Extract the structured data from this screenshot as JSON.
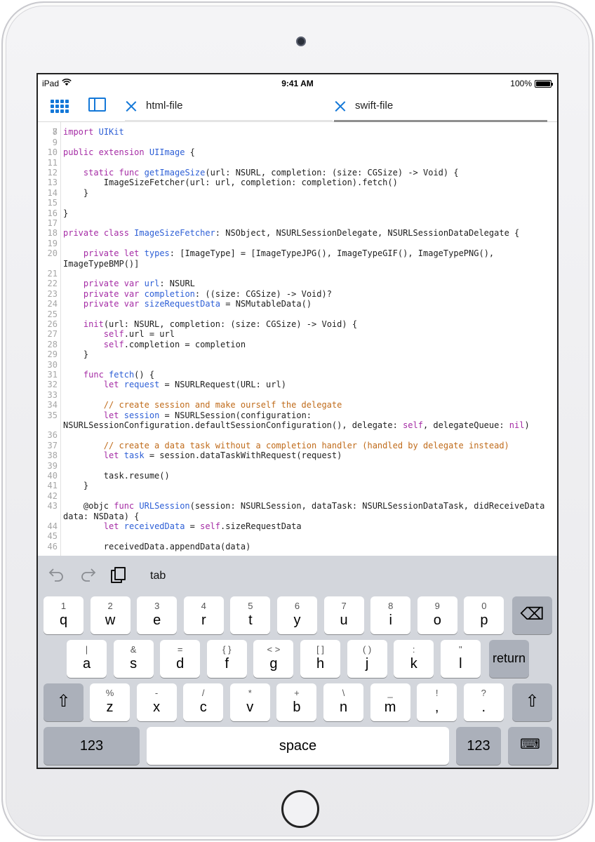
{
  "status_bar": {
    "device": "iPad",
    "time": "9:41 AM",
    "battery": "100%",
    "battery_level": 1.0
  },
  "tabs": [
    {
      "label": "html-file",
      "active": false
    },
    {
      "label": "swift-file",
      "active": true
    }
  ],
  "colors": {
    "accent": "#1478d8",
    "keyword": "#a52ca5",
    "type": "#2d5fd6",
    "comment": "#c06b1a",
    "keyboard_bg": "#d3d6dc"
  },
  "code": {
    "first_line_partial": "7",
    "lines": [
      {
        "n": "8",
        "t": "import UIKit"
      },
      {
        "n": "9",
        "t": ""
      },
      {
        "n": "10",
        "t": "public extension UIImage {"
      },
      {
        "n": "11",
        "t": ""
      },
      {
        "n": "12",
        "t": "    static func getImageSize(url: NSURL, completion: (size: CGSize) -> Void) {"
      },
      {
        "n": "13",
        "t": "        ImageSizeFetcher(url: url, completion: completion).fetch()"
      },
      {
        "n": "14",
        "t": "    }"
      },
      {
        "n": "15",
        "t": ""
      },
      {
        "n": "16",
        "t": "}"
      },
      {
        "n": "17",
        "t": ""
      },
      {
        "n": "18",
        "t": "private class ImageSizeFetcher: NSObject, NSURLSessionDelegate, NSURLSessionDataDelegate {"
      },
      {
        "n": "19",
        "t": ""
      },
      {
        "n": "20",
        "t": "    private let types: [ImageType] = [ImageTypeJPG(), ImageTypeGIF(), ImageTypePNG(),",
        "cont": "ImageTypeBMP()]"
      },
      {
        "n": "21",
        "t": ""
      },
      {
        "n": "22",
        "t": "    private var url: NSURL"
      },
      {
        "n": "23",
        "t": "    private var completion: ((size: CGSize) -> Void)?"
      },
      {
        "n": "24",
        "t": "    private var sizeRequestData = NSMutableData()"
      },
      {
        "n": "25",
        "t": ""
      },
      {
        "n": "26",
        "t": "    init(url: NSURL, completion: (size: CGSize) -> Void) {"
      },
      {
        "n": "27",
        "t": "        self.url = url"
      },
      {
        "n": "28",
        "t": "        self.completion = completion"
      },
      {
        "n": "29",
        "t": "    }"
      },
      {
        "n": "30",
        "t": ""
      },
      {
        "n": "31",
        "t": "    func fetch() {"
      },
      {
        "n": "32",
        "t": "        let request = NSURLRequest(URL: url)"
      },
      {
        "n": "33",
        "t": ""
      },
      {
        "n": "34",
        "t": "        // create session and make ourself the delegate"
      },
      {
        "n": "35",
        "t": "        let session = NSURLSession(configuration:",
        "cont": "NSURLSessionConfiguration.defaultSessionConfiguration(), delegate: self, delegateQueue: nil)"
      },
      {
        "n": "36",
        "t": ""
      },
      {
        "n": "37",
        "t": "        // create a data task without a completion handler (handled by delegate instead)"
      },
      {
        "n": "38",
        "t": "        let task = session.dataTaskWithRequest(request)"
      },
      {
        "n": "39",
        "t": ""
      },
      {
        "n": "40",
        "t": "        task.resume()"
      },
      {
        "n": "41",
        "t": "    }"
      },
      {
        "n": "42",
        "t": ""
      },
      {
        "n": "43",
        "t": "    @objc func URLSession(session: NSURLSession, dataTask: NSURLSessionDataTask, didReceiveData",
        "cont": "data: NSData) {"
      },
      {
        "n": "44",
        "t": "        let receivedData = self.sizeRequestData"
      },
      {
        "n": "45",
        "t": ""
      },
      {
        "n": "46",
        "t": "        receivedData.appendData(data)"
      }
    ]
  },
  "keyboard": {
    "shortcut_tab": "tab",
    "undo_icon": "undo-arrow-icon",
    "redo_icon": "redo-arrow-icon",
    "row1": [
      {
        "hint": "1",
        "key": "q"
      },
      {
        "hint": "2",
        "key": "w"
      },
      {
        "hint": "3",
        "key": "e"
      },
      {
        "hint": "4",
        "key": "r"
      },
      {
        "hint": "5",
        "key": "t"
      },
      {
        "hint": "6",
        "key": "y"
      },
      {
        "hint": "7",
        "key": "u"
      },
      {
        "hint": "8",
        "key": "i"
      },
      {
        "hint": "9",
        "key": "o"
      },
      {
        "hint": "0",
        "key": "p"
      }
    ],
    "row2": [
      {
        "hint": "|",
        "key": "a"
      },
      {
        "hint": "&",
        "key": "s"
      },
      {
        "hint": "=",
        "key": "d"
      },
      {
        "hint": "{   }",
        "key": "f"
      },
      {
        "hint": "<   >",
        "key": "g"
      },
      {
        "hint": "[   ]",
        "key": "h"
      },
      {
        "hint": "(   )",
        "key": "j"
      },
      {
        "hint": ":",
        "key": "k"
      },
      {
        "hint": "\"",
        "key": "l"
      }
    ],
    "row3": [
      {
        "hint": "%",
        "key": "z"
      },
      {
        "hint": "-",
        "key": "x"
      },
      {
        "hint": "/",
        "key": "c"
      },
      {
        "hint": "*",
        "key": "v"
      },
      {
        "hint": "+",
        "key": "b"
      },
      {
        "hint": "\\",
        "key": "n"
      },
      {
        "hint": "_",
        "key": "m"
      },
      {
        "hint": "!",
        "key": ","
      },
      {
        "hint": "?",
        "key": "."
      }
    ],
    "return_label": "return",
    "space_label": "space",
    "numbers_label": "123",
    "delete_glyph": "⌫",
    "shift_glyph": "⇧",
    "dismiss_glyph": "⌨"
  }
}
